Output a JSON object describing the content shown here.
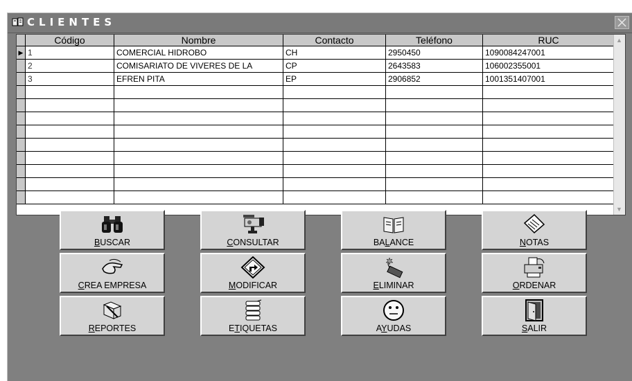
{
  "window": {
    "title": "CLIENTES"
  },
  "grid": {
    "columns": [
      "Código",
      "Nombre",
      "Contacto",
      "Teléfono",
      "RUC"
    ],
    "rows": [
      [
        "1",
        "COMERCIAL HIDROBO",
        "CH",
        "2950450",
        "1090084247001"
      ],
      [
        "2",
        "COMISARIATO DE VIVERES DE LA",
        "CP",
        "2643583",
        "106002355001"
      ],
      [
        "3",
        "EFREN PITA",
        "EP",
        "2906852",
        "1001351407001"
      ]
    ],
    "empty_rows": 9
  },
  "buttons": [
    {
      "id": "buscar",
      "pre": "",
      "key": "B",
      "post": "USCAR",
      "icon": "binoculars-icon"
    },
    {
      "id": "consultar",
      "pre": "",
      "key": "C",
      "post": "ONSULTAR",
      "icon": "video-camera-icon"
    },
    {
      "id": "balance",
      "pre": "BA",
      "key": "L",
      "post": "ANCE",
      "icon": "open-book-icon"
    },
    {
      "id": "notas",
      "pre": "",
      "key": "N",
      "post": "OTAS",
      "icon": "notepad-icon"
    },
    {
      "id": "crea-empresa",
      "pre": "",
      "key": "C",
      "post": "REA EMPRESA",
      "icon": "hand-icon"
    },
    {
      "id": "modificar",
      "pre": "",
      "key": "M",
      "post": "ODIFICAR",
      "icon": "turn-sign-icon"
    },
    {
      "id": "eliminar",
      "pre": "",
      "key": "E",
      "post": "LIMINAR",
      "icon": "dynamite-icon"
    },
    {
      "id": "ordenar",
      "pre": "",
      "key": "O",
      "post": "RDENAR",
      "icon": "printer-icon"
    },
    {
      "id": "reportes",
      "pre": "",
      "key": "R",
      "post": "EPORTES",
      "icon": "tools-icon"
    },
    {
      "id": "etiquetas",
      "pre": "E",
      "key": "T",
      "post": "IQUETAS",
      "icon": "paper-stack-icon"
    },
    {
      "id": "ayudas",
      "pre": "A",
      "key": "Y",
      "post": "UDAS",
      "icon": "smiley-icon"
    },
    {
      "id": "salir",
      "pre": "",
      "key": "S",
      "post": "ALIR",
      "icon": "door-exit-icon"
    }
  ]
}
